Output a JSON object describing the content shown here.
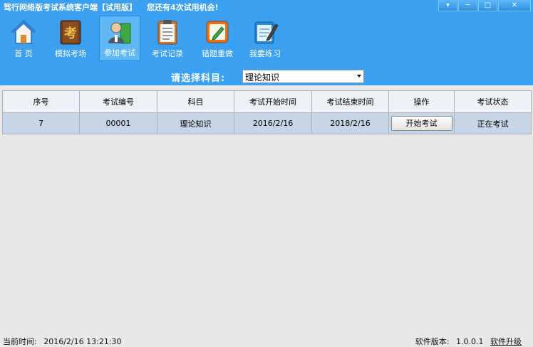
{
  "window": {
    "title": "驾行网络版考试系统客户端【试用版】",
    "trial_notice": "您还有4次试用机会!",
    "minimize": "▾",
    "restore": "─",
    "maximize": "□",
    "close": "✕"
  },
  "toolbar": {
    "items": [
      {
        "label": "首  页",
        "icon": "home-icon"
      },
      {
        "label": "模拟考场",
        "icon": "exam-book-icon"
      },
      {
        "label": "参加考试",
        "icon": "user-book-icon"
      },
      {
        "label": "考试记录",
        "icon": "clipboard-icon"
      },
      {
        "label": "错题重做",
        "icon": "edit-notebook-icon"
      },
      {
        "label": "我要练习",
        "icon": "notepad-pen-icon"
      }
    ],
    "active_index": 2
  },
  "subject": {
    "label": "请选择科目:",
    "selected": "理论知识"
  },
  "table": {
    "headers": [
      "序号",
      "考试编号",
      "科目",
      "考试开始时间",
      "考试结束时间",
      "操作",
      "考试状态"
    ],
    "rows": [
      {
        "seq": "7",
        "exam_no": "00001",
        "subject": "理论知识",
        "start": "2016/2/16",
        "end": "2018/2/16",
        "action": "开始考试",
        "status": "正在考试"
      }
    ]
  },
  "statusbar": {
    "time_label": "当前时间:",
    "time_value": "2016/2/16 13:21:30",
    "version_label": "软件版本:",
    "version_value": "1.0.0.1",
    "upgrade": "软件升级"
  },
  "colors": {
    "header_blue": "#3aa0ef",
    "row_blue": "#c6d6e6",
    "body_gray": "#e9e9e9"
  }
}
